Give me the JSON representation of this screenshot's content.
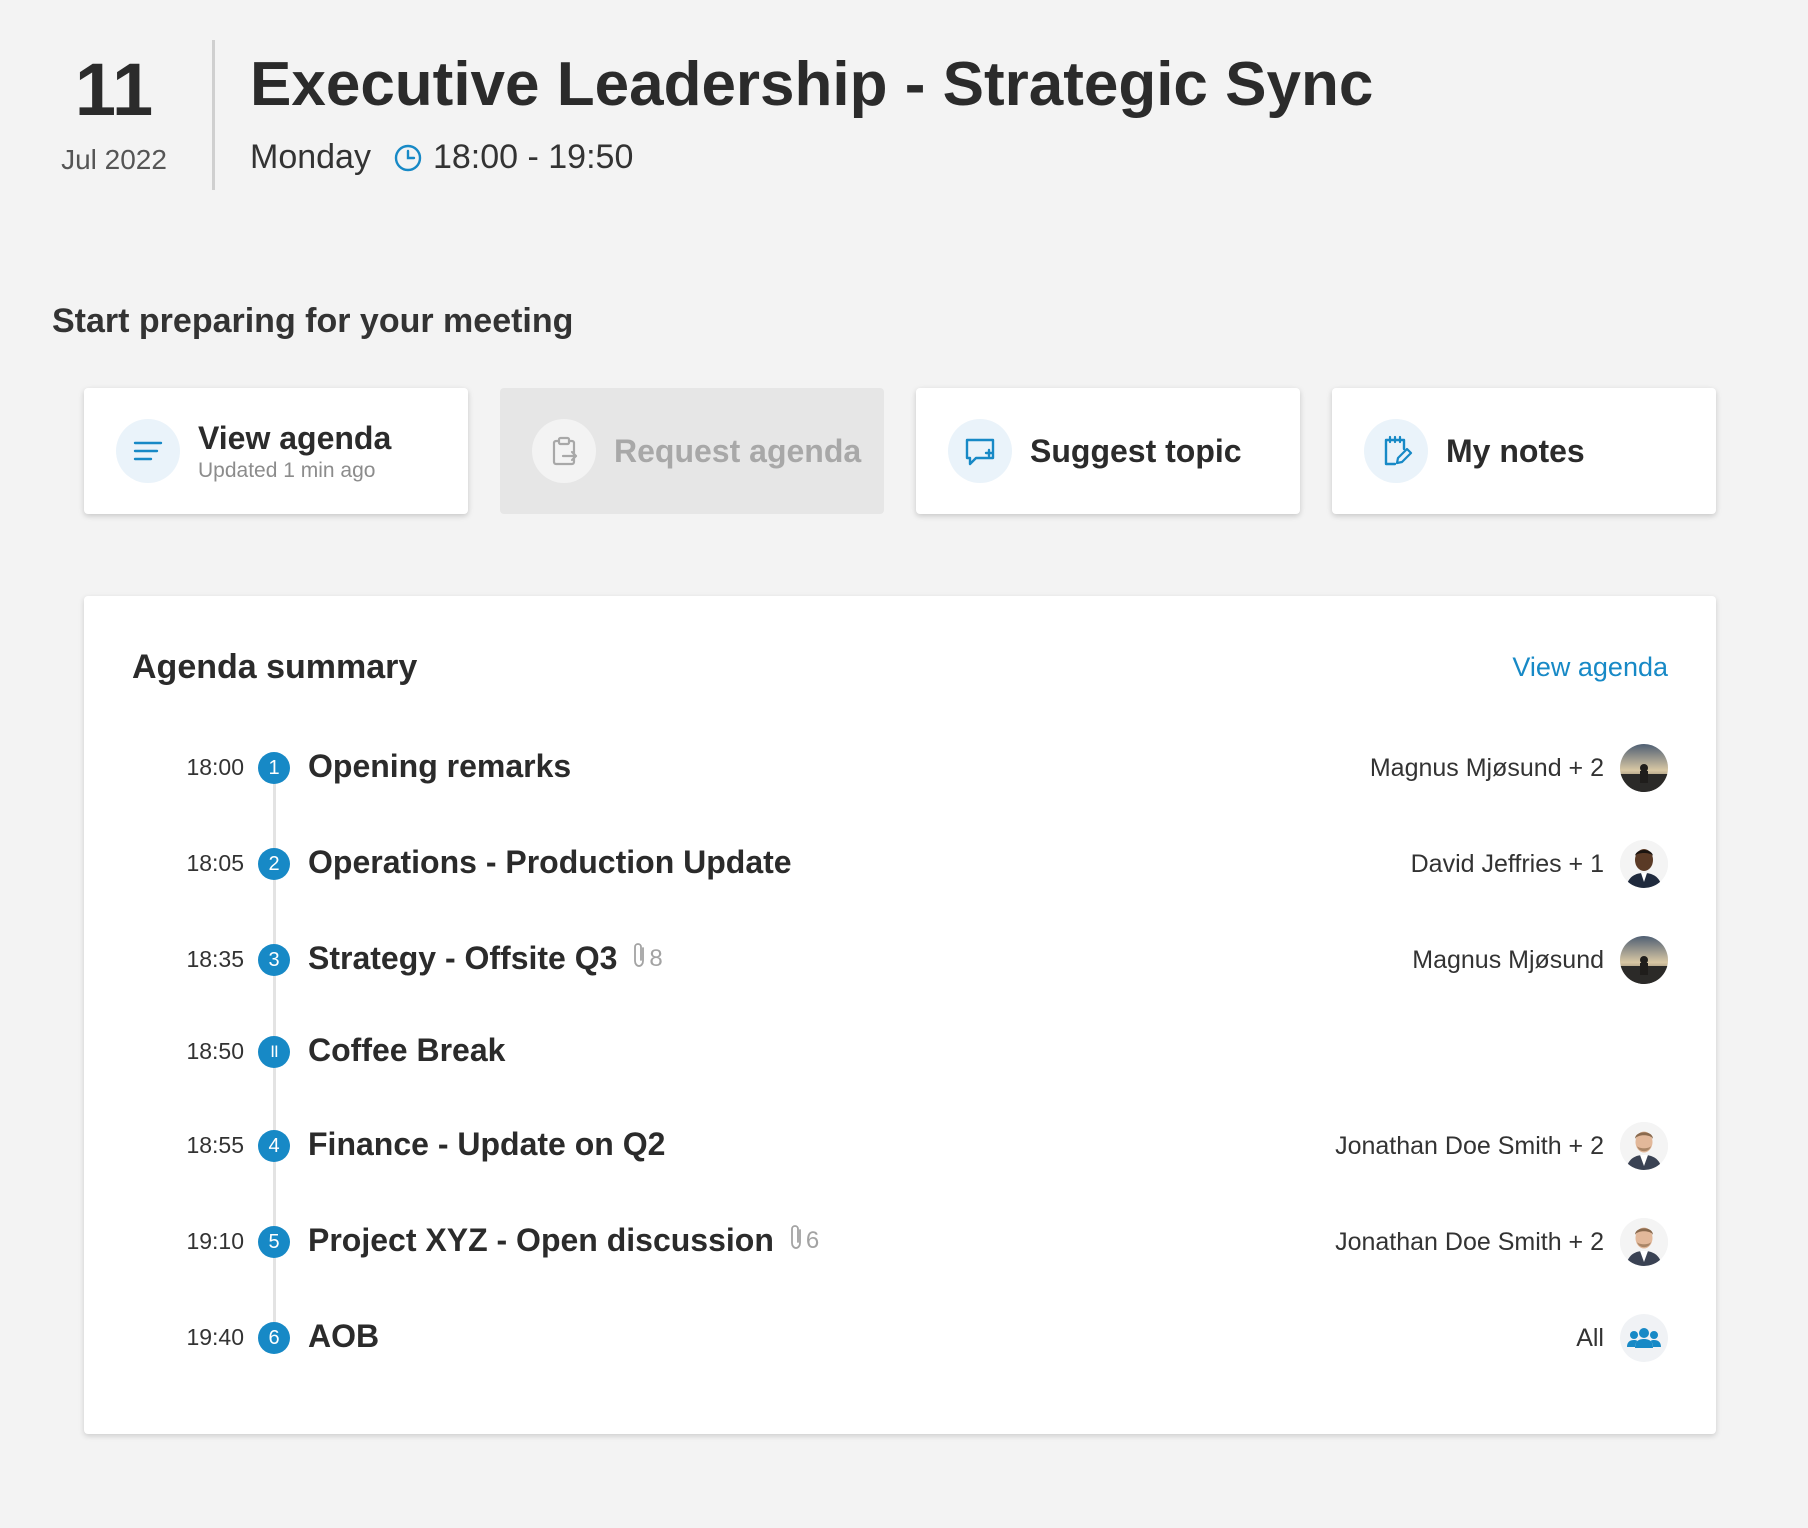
{
  "meeting": {
    "day": "11",
    "month_year": "Jul 2022",
    "title": "Executive Leadership - Strategic Sync",
    "weekday": "Monday",
    "time_range": "18:00 - 19:50",
    "icon": "clock-icon"
  },
  "prepare": {
    "title": "Start preparing for your meeting",
    "cards": [
      {
        "label": "View agenda",
        "sub": "Updated 1 min ago",
        "icon": "agenda-lines-icon",
        "enabled": true
      },
      {
        "label": "Request agenda",
        "sub": "",
        "icon": "clipboard-request-icon",
        "enabled": false
      },
      {
        "label": "Suggest topic",
        "sub": "",
        "icon": "chat-plus-icon",
        "enabled": true
      },
      {
        "label": "My notes",
        "sub": "",
        "icon": "notepad-pen-icon",
        "enabled": true
      }
    ]
  },
  "summary": {
    "title": "Agenda summary",
    "link": "View agenda",
    "items": [
      {
        "time": "18:00",
        "marker": "1",
        "title": "Opening remarks",
        "attachments": "",
        "presenter": "Magnus Mjøsund + 2",
        "avatar": "landscape"
      },
      {
        "time": "18:05",
        "marker": "2",
        "title": "Operations - Production Update",
        "attachments": "",
        "presenter": "David Jeffries + 1",
        "avatar": "person-dark"
      },
      {
        "time": "18:35",
        "marker": "3",
        "title": "Strategy - Offsite Q3",
        "attachments": "8",
        "presenter": "Magnus Mjøsund",
        "avatar": "landscape"
      },
      {
        "time": "18:50",
        "marker": "II",
        "title": "Coffee Break",
        "attachments": "",
        "presenter": "",
        "avatar": ""
      },
      {
        "time": "18:55",
        "marker": "4",
        "title": "Finance - Update on Q2",
        "attachments": "",
        "presenter": "Jonathan Doe Smith + 2",
        "avatar": "person-light"
      },
      {
        "time": "19:10",
        "marker": "5",
        "title": "Project XYZ - Open discussion",
        "attachments": "6",
        "presenter": "Jonathan Doe Smith + 2",
        "avatar": "person-light"
      },
      {
        "time": "19:40",
        "marker": "6",
        "title": "AOB",
        "attachments": "",
        "presenter": "All",
        "avatar": "group"
      }
    ]
  },
  "colors": {
    "accent": "#1789c6",
    "background": "#f3f3f3",
    "card": "#ffffff",
    "disabled_card": "#e6e6e6"
  }
}
